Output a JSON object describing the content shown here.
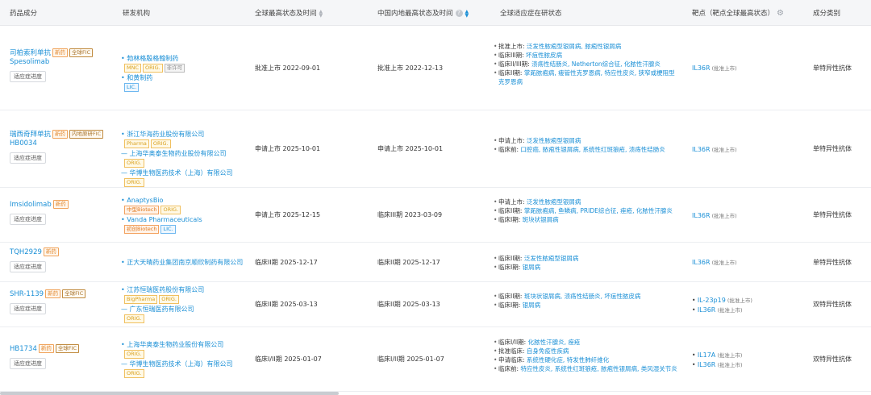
{
  "headers": {
    "drug": "药品成分",
    "org": "研发机构",
    "global": "全球最高状态及时间",
    "china": "中国内地最高状态及时间",
    "indication": "全球适应症在研状态",
    "target": "靶点（靶点全球最高状态）",
    "cls": "成分类别"
  },
  "btn_label": "适应症进度",
  "rows": [
    {
      "name1": "司柏索利单抗",
      "name2": "Spesolimab",
      "badges": [
        "新药",
        "全球FIC"
      ],
      "orgs": [
        {
          "name": "勃林格殷格翰制药",
          "tags": [
            "MNC",
            "ORIG.",
            "非许可"
          ]
        },
        {
          "name": "和黄制药",
          "tags": [
            "LIC."
          ]
        }
      ],
      "global": "批准上市 2022-09-01",
      "china": "批准上市 2022-12-13",
      "ind": [
        {
          "k": "批准上市:",
          "v": "泛发性脓疱型银屑病, 脓疱性银屑病"
        },
        {
          "k": "临床III期:",
          "v": "坏疽性脓皮病"
        },
        {
          "k": "临床II/III期:",
          "v": "溃疡性结肠炎, Netherton综合征, 化脓性汗腺炎"
        },
        {
          "k": "临床II期:",
          "v": "掌跖脓疱病, 瘘管性克罗恩病, 特应性皮炎, 狭窄或梗阻型克罗恩病"
        }
      ],
      "targets": [
        {
          "t": "IL36R",
          "s": "(批准上市)"
        }
      ],
      "cls": "单特异性抗体"
    },
    {
      "name1": "瑞西奇拜单抗",
      "name2": "HB0034",
      "badges": [
        "新药",
        "内地原研FIC"
      ],
      "orgs": [
        {
          "name": "浙江华海药业股份有限公司",
          "tags": [
            "Pharma",
            "ORIG."
          ]
        },
        {
          "name": "-- 上海华奥泰生物药业股份有限公司",
          "tags": [
            "ORIG."
          ]
        },
        {
          "name": "-- 华博生物医药技术（上海）有限公司",
          "tags": [
            "ORIG."
          ]
        }
      ],
      "global": "申请上市 2025-10-01",
      "china": "申请上市 2025-10-01",
      "ind": [
        {
          "k": "申请上市:",
          "v": "泛发性脓疱型银屑病"
        },
        {
          "k": "临床前:",
          "v": "口腔癌, 脓疱性银屑病, 系统性红斑狼疮, 溃疡性结肠炎"
        }
      ],
      "targets": [
        {
          "t": "IL36R",
          "s": "(批准上市)"
        }
      ],
      "cls": "单特异性抗体"
    },
    {
      "name1": "Imsidolimab",
      "name2": "",
      "badges": [
        "新药"
      ],
      "orgs": [
        {
          "name": "AnaptysBio",
          "tags": [
            "中型Biotech",
            "ORIG."
          ]
        },
        {
          "name": "Vanda Pharmaceuticals",
          "tags": []
        },
        {
          "name": "",
          "tags": [
            "初创Biotech",
            "LIC."
          ]
        }
      ],
      "global": "申请上市 2025-12-15",
      "china": "临床III期 2023-03-09",
      "ind": [
        {
          "k": "申请上市:",
          "v": "泛发性脓疱型银屑病"
        },
        {
          "k": "临床II期:",
          "v": "掌跖脓疱病, 鱼鳞病, PRIDE综合征, 痤疮, 化脓性汗腺炎"
        },
        {
          "k": "临床I期:",
          "v": "斑块状银屑病"
        }
      ],
      "targets": [
        {
          "t": "IL36R",
          "s": "(批准上市)"
        }
      ],
      "cls": "单特异性抗体"
    },
    {
      "name1": "TQH2929",
      "name2": "",
      "badges": [
        "新药"
      ],
      "orgs": [
        {
          "name": "正大天晴药业集团南京顺欣制药有限公司",
          "tags": []
        }
      ],
      "global": "临床II期 2025-12-17",
      "china": "临床II期 2025-12-17",
      "ind": [
        {
          "k": "临床II期:",
          "v": "泛发性脓疱型银屑病"
        },
        {
          "k": "临床I期:",
          "v": "银屑病"
        }
      ],
      "targets": [
        {
          "t": "IL36R",
          "s": "(批准上市)"
        }
      ],
      "cls": "单特异性抗体"
    },
    {
      "name1": "SHR-1139",
      "name2": "",
      "badges": [
        "新药",
        "全球FIC"
      ],
      "orgs": [
        {
          "name": "江苏恒瑞医药股份有限公司",
          "tags": []
        },
        {
          "name": "",
          "tags": [
            "BigPharma",
            "ORIG."
          ]
        },
        {
          "name": "-- 广东恒瑞医药有限公司",
          "tags": [
            "ORIG."
          ]
        }
      ],
      "global": "临床II期 2025-03-13",
      "china": "临床II期 2025-03-13",
      "ind": [
        {
          "k": "临床II期:",
          "v": "斑块状银屑病, 溃疡性结肠炎, 坏疽性脓皮病"
        },
        {
          "k": "临床I期:",
          "v": "银屑病"
        }
      ],
      "targets": [
        {
          "t": "IL-23p19",
          "s": "(批准上市)"
        },
        {
          "t": "IL36R",
          "s": "(批准上市)"
        }
      ],
      "cls": "双特异性抗体"
    },
    {
      "name1": "HB1734",
      "name2": "",
      "badges": [
        "新药",
        "全球FIC"
      ],
      "orgs": [
        {
          "name": "上海华奥泰生物药业股份有限公司",
          "tags": []
        },
        {
          "name": "",
          "tags": [
            "ORIG."
          ]
        },
        {
          "name": "-- 华博生物医药技术（上海）有限公司",
          "tags": [
            "ORIG."
          ]
        }
      ],
      "global": "临床I/II期 2025-01-07",
      "china": "临床I/II期 2025-01-07",
      "ind": [
        {
          "k": "临床I/II期:",
          "v": "化脓性汗腺炎, 痤疮"
        },
        {
          "k": "批准临床:",
          "v": "自身免疫性疾病"
        },
        {
          "k": "申请临床:",
          "v": "系统性硬化症, 特发性肺纤维化"
        },
        {
          "k": "临床前:",
          "v": "特应性皮炎, 系统性红斑狼疮, 脓疱性银屑病, 类风湿关节炎"
        }
      ],
      "targets": [
        {
          "t": "IL17A",
          "s": "(批准上市)"
        },
        {
          "t": "IL36R",
          "s": "(批准上市)"
        }
      ],
      "cls": "双特异性抗体"
    }
  ]
}
